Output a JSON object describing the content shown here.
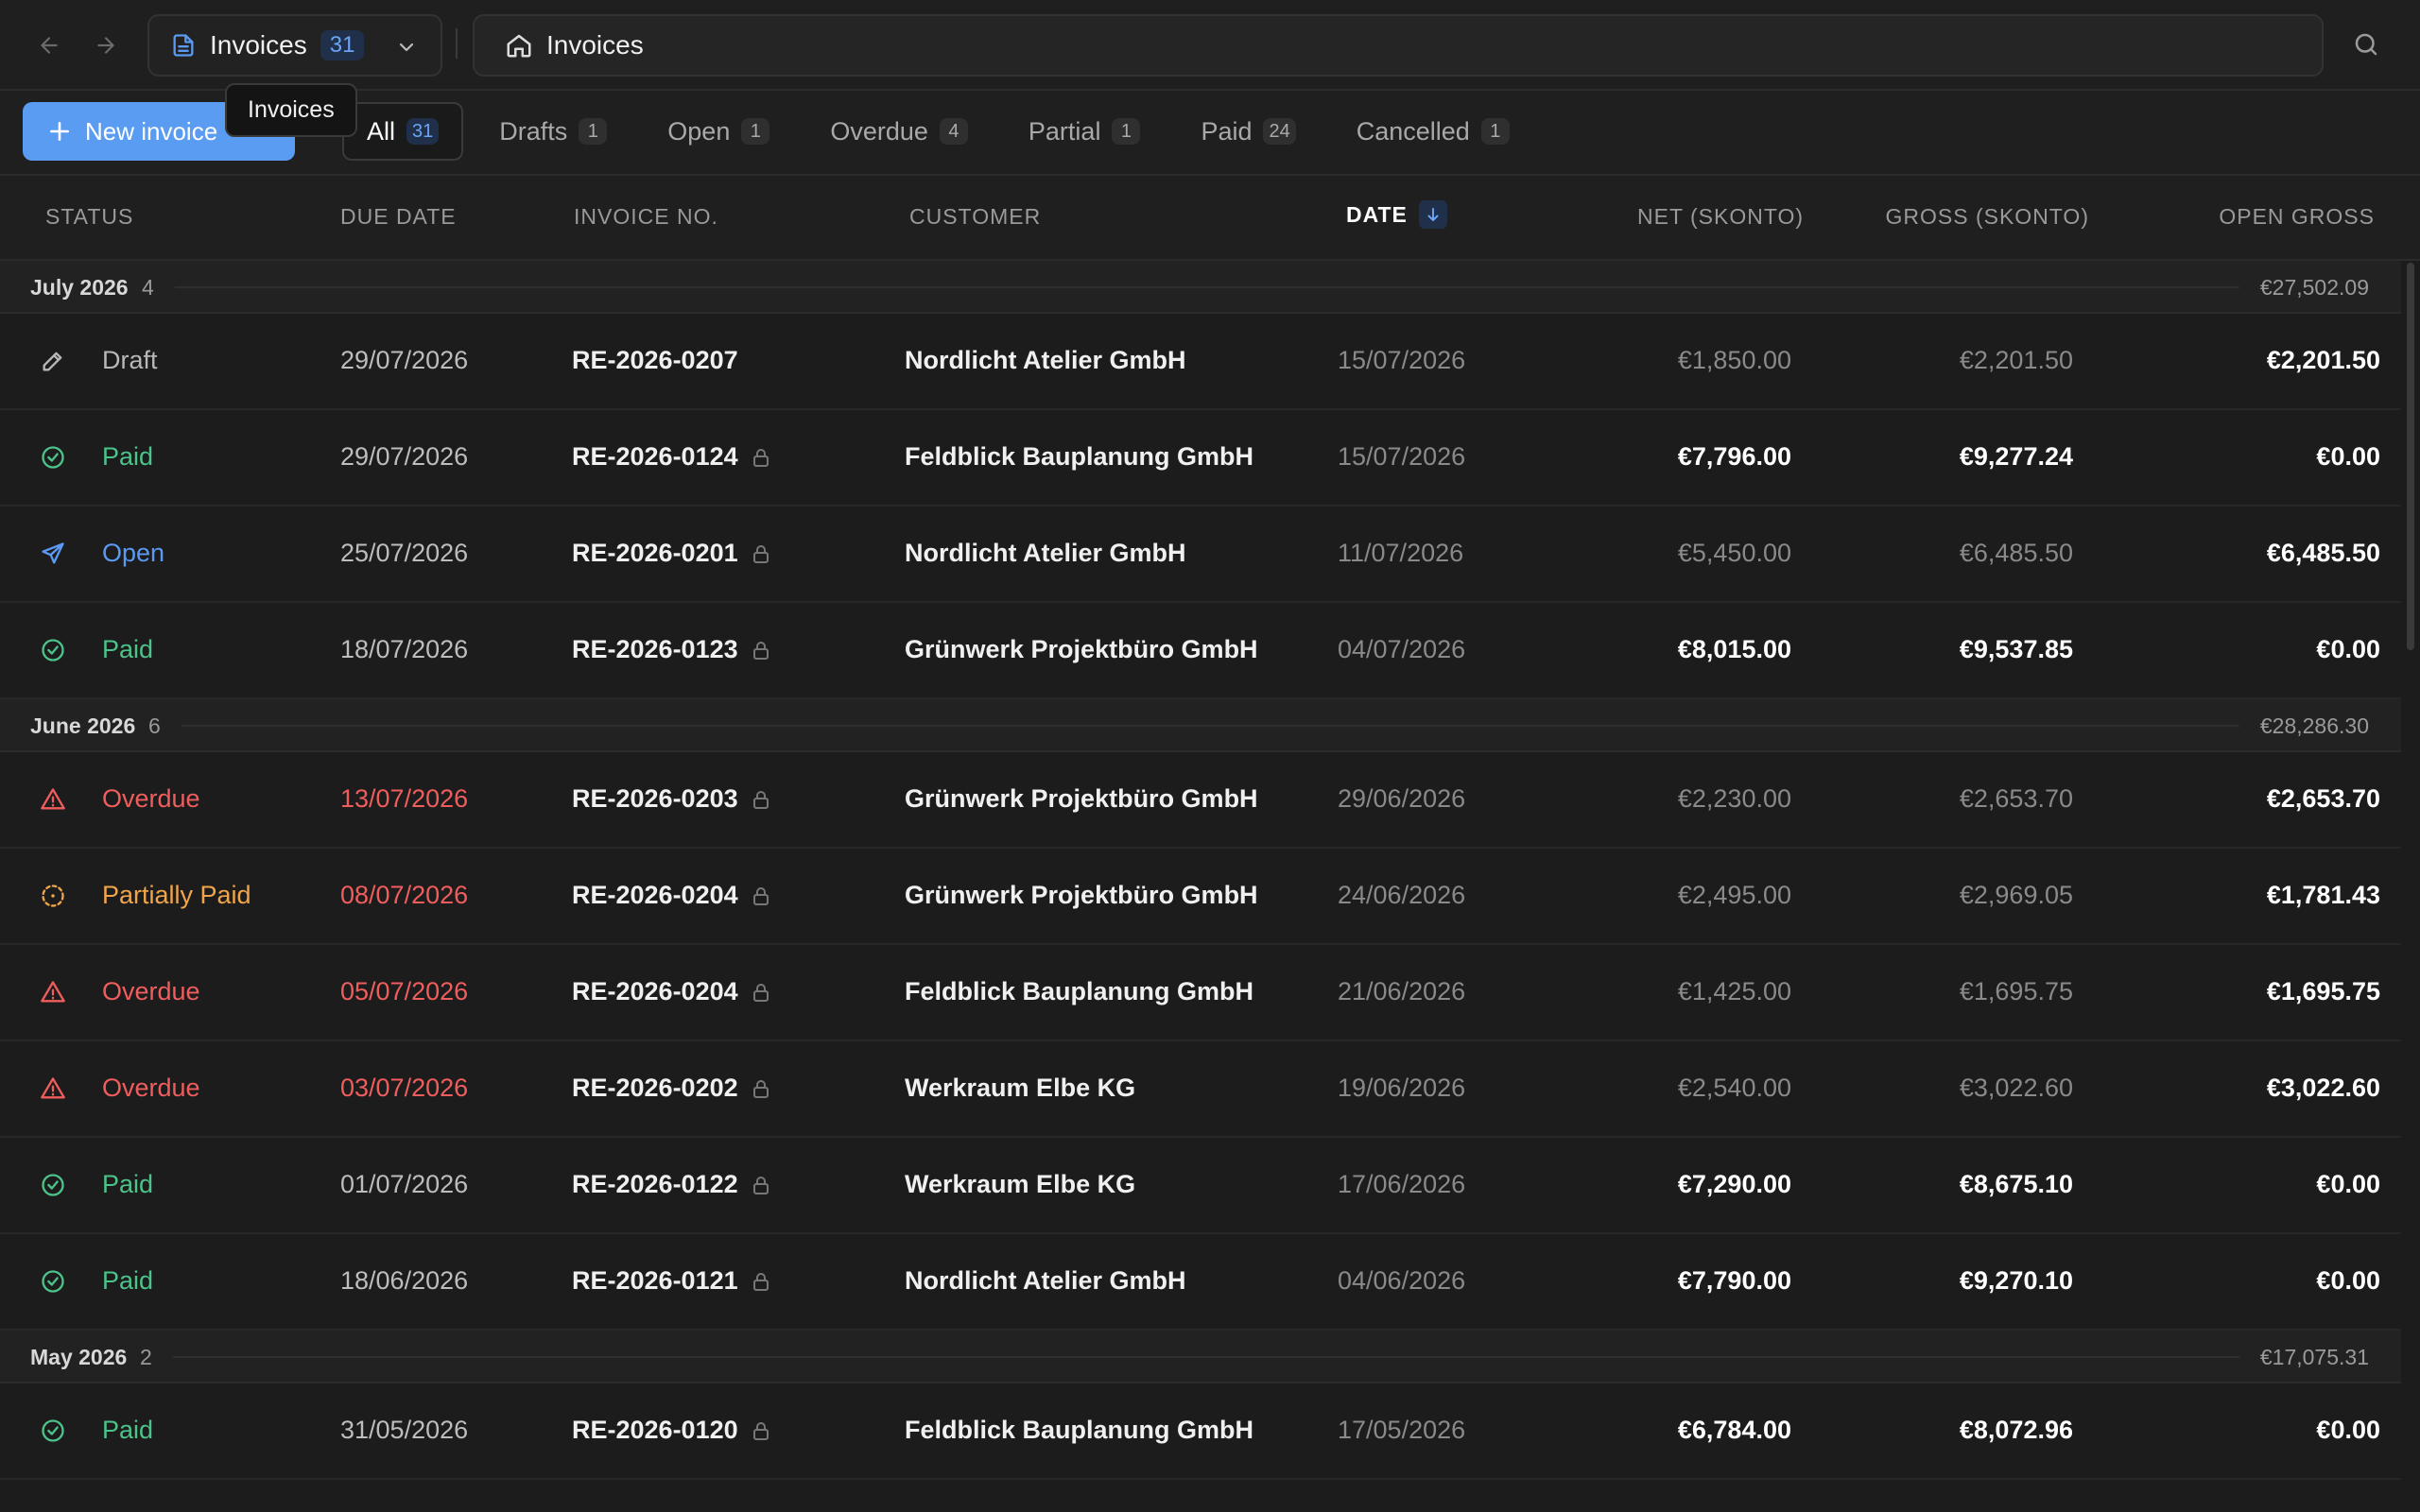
{
  "header": {
    "selector_label": "Invoices",
    "selector_count": "31",
    "address_label": "Invoices"
  },
  "toolbar": {
    "new_invoice_label": "New invoice",
    "tooltip": "Invoices"
  },
  "tabs": [
    {
      "label": "All",
      "count": "31",
      "active": true
    },
    {
      "label": "Drafts",
      "count": "1"
    },
    {
      "label": "Open",
      "count": "1"
    },
    {
      "label": "Overdue",
      "count": "4"
    },
    {
      "label": "Partial",
      "count": "1"
    },
    {
      "label": "Paid",
      "count": "24"
    },
    {
      "label": "Cancelled",
      "count": "1"
    }
  ],
  "columns": {
    "status": "STATUS",
    "due_date": "DUE DATE",
    "invoice_no": "INVOICE NO.",
    "customer": "CUSTOMER",
    "date": "DATE",
    "net": "NET (SKONTO)",
    "gross": "GROSS (SKONTO)",
    "open_gross": "OPEN GROSS"
  },
  "groups": [
    {
      "title": "July 2026",
      "count": "4",
      "total": "€27,502.09",
      "rows": [
        {
          "status": "Draft",
          "status_key": "draft",
          "due": "29/07/2026",
          "due_late": false,
          "invoice": "RE-2026-0207",
          "locked": false,
          "customer": "Nordlicht Atelier GmbH",
          "date": "15/07/2026",
          "net": "€1,850.00",
          "gross": "€2,201.50",
          "open": "€2,201.50",
          "amount_strong": false
        },
        {
          "status": "Paid",
          "status_key": "paid",
          "due": "29/07/2026",
          "due_late": false,
          "invoice": "RE-2026-0124",
          "locked": true,
          "customer": "Feldblick Bauplanung GmbH",
          "date": "15/07/2026",
          "net": "€7,796.00",
          "gross": "€9,277.24",
          "open": "€0.00",
          "amount_strong": true
        },
        {
          "status": "Open",
          "status_key": "open",
          "due": "25/07/2026",
          "due_late": false,
          "invoice": "RE-2026-0201",
          "locked": true,
          "customer": "Nordlicht Atelier GmbH",
          "date": "11/07/2026",
          "net": "€5,450.00",
          "gross": "€6,485.50",
          "open": "€6,485.50",
          "amount_strong": false
        },
        {
          "status": "Paid",
          "status_key": "paid",
          "due": "18/07/2026",
          "due_late": false,
          "invoice": "RE-2026-0123",
          "locked": true,
          "customer": "Grünwerk Projektbüro GmbH",
          "date": "04/07/2026",
          "net": "€8,015.00",
          "gross": "€9,537.85",
          "open": "€0.00",
          "amount_strong": true
        }
      ]
    },
    {
      "title": "June 2026",
      "count": "6",
      "total": "€28,286.30",
      "rows": [
        {
          "status": "Overdue",
          "status_key": "overdue",
          "due": "13/07/2026",
          "due_late": true,
          "invoice": "RE-2026-0203",
          "locked": true,
          "customer": "Grünwerk Projektbüro GmbH",
          "date": "29/06/2026",
          "net": "€2,230.00",
          "gross": "€2,653.70",
          "open": "€2,653.70",
          "amount_strong": false
        },
        {
          "status": "Partially Paid",
          "status_key": "partial",
          "due": "08/07/2026",
          "due_late": true,
          "invoice": "RE-2026-0204",
          "locked": true,
          "customer": "Grünwerk Projektbüro GmbH",
          "date": "24/06/2026",
          "net": "€2,495.00",
          "gross": "€2,969.05",
          "open": "€1,781.43",
          "amount_strong": false
        },
        {
          "status": "Overdue",
          "status_key": "overdue",
          "due": "05/07/2026",
          "due_late": true,
          "invoice": "RE-2026-0204",
          "locked": true,
          "customer": "Feldblick Bauplanung GmbH",
          "date": "21/06/2026",
          "net": "€1,425.00",
          "gross": "€1,695.75",
          "open": "€1,695.75",
          "amount_strong": false
        },
        {
          "status": "Overdue",
          "status_key": "overdue",
          "due": "03/07/2026",
          "due_late": true,
          "invoice": "RE-2026-0202",
          "locked": true,
          "customer": "Werkraum Elbe KG",
          "date": "19/06/2026",
          "net": "€2,540.00",
          "gross": "€3,022.60",
          "open": "€3,022.60",
          "amount_strong": false
        },
        {
          "status": "Paid",
          "status_key": "paid",
          "due": "01/07/2026",
          "due_late": false,
          "invoice": "RE-2026-0122",
          "locked": true,
          "customer": "Werkraum Elbe KG",
          "date": "17/06/2026",
          "net": "€7,290.00",
          "gross": "€8,675.10",
          "open": "€0.00",
          "amount_strong": true
        },
        {
          "status": "Paid",
          "status_key": "paid",
          "due": "18/06/2026",
          "due_late": false,
          "invoice": "RE-2026-0121",
          "locked": true,
          "customer": "Nordlicht Atelier GmbH",
          "date": "04/06/2026",
          "net": "€7,790.00",
          "gross": "€9,270.10",
          "open": "€0.00",
          "amount_strong": true
        }
      ]
    },
    {
      "title": "May 2026",
      "count": "2",
      "total": "€17,075.31",
      "rows": [
        {
          "status": "Paid",
          "status_key": "paid",
          "due": "31/05/2026",
          "due_late": false,
          "invoice": "RE-2026-0120",
          "locked": true,
          "customer": "Feldblick Bauplanung GmbH",
          "date": "17/05/2026",
          "net": "€6,784.00",
          "gross": "€8,072.96",
          "open": "€0.00",
          "amount_strong": true
        }
      ]
    }
  ],
  "icons": {
    "draft": "pencil-icon",
    "paid": "check-circle-icon",
    "open": "send-icon",
    "overdue": "warning-triangle-icon",
    "partial": "dashed-circle-icon"
  },
  "colors": {
    "accent": "#5a9cf2",
    "paid": "#4cc38a",
    "open": "#5a9af2",
    "overdue": "#ef5d5d",
    "partial": "#f0a54a"
  }
}
